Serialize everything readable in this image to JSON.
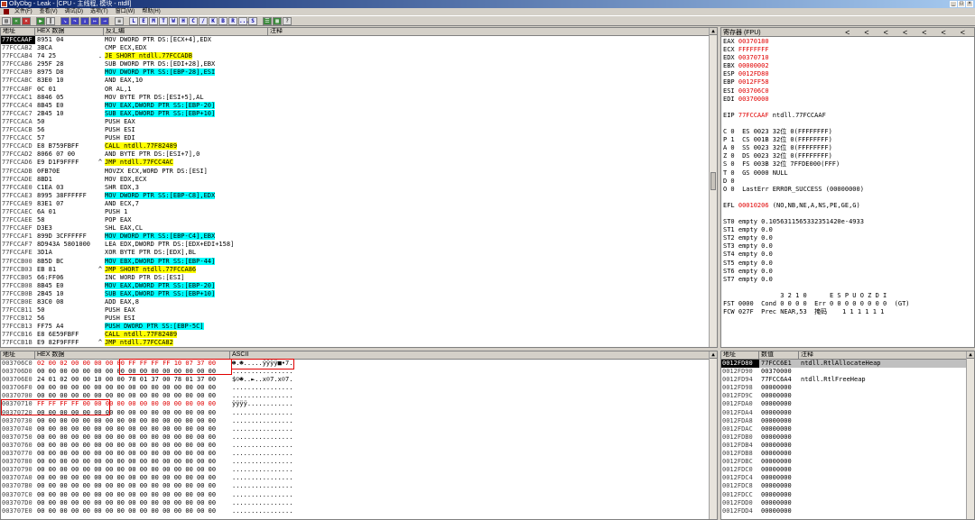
{
  "window": {
    "title": "OllyDbg - Leak - [CPU - 主线程, 模块 - ntdll]"
  },
  "menu": [
    "文件(F)",
    "查看(V)",
    "调试(D)",
    "选项(T)",
    "窗口(W)",
    "帮助(H)"
  ],
  "toolbar": {
    "letters": [
      "L",
      "E",
      "M",
      "T",
      "W",
      "H",
      "C",
      "/",
      "K",
      "B",
      "R",
      "...",
      "S"
    ]
  },
  "disasm": {
    "headers": [
      "地址",
      "HEX 数据",
      "反汇编",
      "注释"
    ],
    "rows": [
      {
        "addr": "77FCCAAF",
        "hex": "8951 04",
        "jmp": "",
        "code": "MOV DWORD PTR DS:[ECX+4],EDX",
        "hl": "",
        "sel": true
      },
      {
        "addr": "77FCCAB2",
        "hex": "3BCA",
        "jmp": "",
        "code": "CMP ECX,EDX",
        "hl": ""
      },
      {
        "addr": "77FCCAB4",
        "hex": "74 25",
        "jmp": ".",
        "code": "JE SHORT ntdll.77FCCADB",
        "hl": "y"
      },
      {
        "addr": "77FCCAB6",
        "hex": "295F 28",
        "jmp": "",
        "code": "SUB DWORD PTR DS:[EDI+28],EBX",
        "hl": ""
      },
      {
        "addr": "77FCCAB9",
        "hex": "8975 D8",
        "jmp": "",
        "code": "MOV DWORD PTR SS:[EBP-28],ESI",
        "hl": "c"
      },
      {
        "addr": "77FCCABC",
        "hex": "83E0 10",
        "jmp": "",
        "code": "AND EAX,10",
        "hl": ""
      },
      {
        "addr": "77FCCABF",
        "hex": "0C 01",
        "jmp": "",
        "code": "OR AL,1",
        "hl": ""
      },
      {
        "addr": "77FCCAC1",
        "hex": "8846 05",
        "jmp": "",
        "code": "MOV BYTE PTR DS:[ESI+5],AL",
        "hl": ""
      },
      {
        "addr": "77FCCAC4",
        "hex": "8B45 E0",
        "jmp": "",
        "code": "MOV EAX,DWORD PTR SS:[EBP-20]",
        "hl": "c"
      },
      {
        "addr": "77FCCAC7",
        "hex": "2B45 10",
        "jmp": "",
        "code": "SUB EAX,DWORD PTR SS:[EBP+10]",
        "hl": "c"
      },
      {
        "addr": "77FCCACA",
        "hex": "50",
        "jmp": "",
        "code": "PUSH EAX",
        "hl": ""
      },
      {
        "addr": "77FCCACB",
        "hex": "56",
        "jmp": "",
        "code": "PUSH ESI",
        "hl": ""
      },
      {
        "addr": "77FCCACC",
        "hex": "57",
        "jmp": "",
        "code": "PUSH EDI",
        "hl": ""
      },
      {
        "addr": "77FCCACD",
        "hex": "E8 B759FBFF",
        "jmp": "",
        "code": "CALL ntdll.77F82489",
        "hl": "y"
      },
      {
        "addr": "77FCCAD2",
        "hex": "8066 07 00",
        "jmp": "",
        "code": "AND BYTE PTR DS:[ESI+7],0",
        "hl": ""
      },
      {
        "addr": "77FCCAD6",
        "hex": "E9 D1F9FFFF",
        "jmp": "^",
        "code": "JMP ntdll.77FCC4AC",
        "hl": "y"
      },
      {
        "addr": "77FCCADB",
        "hex": "0FB70E",
        "jmp": "",
        "code": "MOVZX ECX,WORD PTR DS:[ESI]",
        "hl": ""
      },
      {
        "addr": "77FCCADE",
        "hex": "8BD1",
        "jmp": "",
        "code": "MOV EDX,ECX",
        "hl": ""
      },
      {
        "addr": "77FCCAE0",
        "hex": "C1EA 03",
        "jmp": "",
        "code": "SHR EDX,3",
        "hl": ""
      },
      {
        "addr": "77FCCAE3",
        "hex": "8995 38FFFFFF",
        "jmp": "",
        "code": "MOV DWORD PTR SS:[EBP-C8],EDX",
        "hl": "c"
      },
      {
        "addr": "77FCCAE9",
        "hex": "83E1 07",
        "jmp": "",
        "code": "AND ECX,7",
        "hl": ""
      },
      {
        "addr": "77FCCAEC",
        "hex": "6A 01",
        "jmp": "",
        "code": "PUSH 1",
        "hl": ""
      },
      {
        "addr": "77FCCAEE",
        "hex": "58",
        "jmp": "",
        "code": "POP EAX",
        "hl": ""
      },
      {
        "addr": "77FCCAEF",
        "hex": "D3E3",
        "jmp": "",
        "code": "SHL EAX,CL",
        "hl": ""
      },
      {
        "addr": "77FCCAF1",
        "hex": "899D 3CFFFFFF",
        "jmp": "",
        "code": "MOV DWORD PTR SS:[EBP-C4],EBX",
        "hl": "c"
      },
      {
        "addr": "77FCCAF7",
        "hex": "8D943A 5801000",
        "jmp": "",
        "code": "LEA EDX,DWORD PTR DS:[EDX+EDI+158]",
        "hl": ""
      },
      {
        "addr": "77FCCAFE",
        "hex": "3D1A",
        "jmp": "",
        "code": "XOR BYTE PTR DS:[EDX],BL",
        "hl": ""
      },
      {
        "addr": "77FCCB00",
        "hex": "8B5D BC",
        "jmp": "",
        "code": "MOV EBX,DWORD PTR SS:[EBP-44]",
        "hl": "c"
      },
      {
        "addr": "77FCCB03",
        "hex": "EB 81",
        "jmp": "^",
        "code": "JMP SHORT ntdll.77FCCA86",
        "hl": "y"
      },
      {
        "addr": "77FCCB05",
        "hex": "66:FF06",
        "jmp": "",
        "code": "INC WORD PTR DS:[ESI]",
        "hl": ""
      },
      {
        "addr": "77FCCB08",
        "hex": "8B45 E0",
        "jmp": "",
        "code": "MOV EAX,DWORD PTR SS:[EBP-20]",
        "hl": "c"
      },
      {
        "addr": "77FCCB0B",
        "hex": "2B45 10",
        "jmp": "",
        "code": "SUB EAX,DWORD PTR SS:[EBP+10]",
        "hl": "c"
      },
      {
        "addr": "77FCCB0E",
        "hex": "83C0 08",
        "jmp": "",
        "code": "ADD EAX,8",
        "hl": ""
      },
      {
        "addr": "77FCCB11",
        "hex": "50",
        "jmp": "",
        "code": "PUSH EAX",
        "hl": ""
      },
      {
        "addr": "77FCCB12",
        "hex": "56",
        "jmp": "",
        "code": "PUSH ESI",
        "hl": ""
      },
      {
        "addr": "77FCCB13",
        "hex": "FF75 A4",
        "jmp": "",
        "code": "PUSH DWORD PTR SS:[EBP-5C]",
        "hl": "c"
      },
      {
        "addr": "77FCCB16",
        "hex": "E8 6E59FBFF",
        "jmp": "",
        "code": "CALL ntdll.77F82489",
        "hl": "y"
      },
      {
        "addr": "77FCCB1B",
        "hex": "E9 82F9FFFF",
        "jmp": "^",
        "code": "JMP ntdll.77FCCA82",
        "hl": "y"
      }
    ]
  },
  "registers": {
    "title": "寄存器 (FPU)",
    "nav": [
      "<",
      "<",
      "<",
      "<",
      "<",
      "<",
      "<"
    ],
    "gp": [
      {
        "name": "EAX",
        "val": "00370180"
      },
      {
        "name": "ECX",
        "val": "FFFFFFFF"
      },
      {
        "name": "EDX",
        "val": "00370710"
      },
      {
        "name": "EBX",
        "val": "00000002"
      },
      {
        "name": "ESP",
        "val": "0012FD80"
      },
      {
        "name": "EBP",
        "val": "0012FF58"
      },
      {
        "name": "ESI",
        "val": "003706C0"
      },
      {
        "name": "EDI",
        "val": "00370000"
      }
    ],
    "eip": {
      "name": "EIP",
      "val": "77FCCAAF",
      "sym": "ntdll.77FCCAAF"
    },
    "flags": [
      "C 0  ES 0023 32位 0(FFFFFFFF)",
      "P 1  CS 001B 32位 0(FFFFFFFF)",
      "A 0  SS 0023 32位 0(FFFFFFFF)",
      "Z 0  DS 0023 32位 0(FFFFFFFF)",
      "S 0  FS 003B 32位 7FFDE000(FFF)",
      "T 0  GS 0000 NULL",
      "D 0",
      "O 0  LastErr ERROR_SUCCESS (00000000)"
    ],
    "efl": {
      "name": "EFL",
      "val": "00010206",
      "desc": "(NO,NB,NE,A,NS,PE,GE,G)"
    },
    "fpu": [
      "ST0 empty 0.1056311565332351420e-4933",
      "ST1 empty 0.0",
      "ST2 empty 0.0",
      "ST3 empty 0.0",
      "ST4 empty 0.0",
      "ST5 empty 0.0",
      "ST6 empty 0.0",
      "ST7 empty 0.0"
    ],
    "fpu_status": [
      "               3 2 1 0      E S P U O Z D I",
      "FST 0000  Cond 0 0 0 0  Err 0 0 0 0 0 0 0 0  (GT)",
      "FCW 027F  Prec NEAR,53  掩码    1 1 1 1 1 1"
    ]
  },
  "dump": {
    "headers": [
      "地址",
      "HEX 数据",
      "ASCII"
    ],
    "rows": [
      {
        "addr": "003706C0",
        "hex": "02 00 02 00 00 00 00 00 FF FF FF FF 10 07 37 00",
        "ascii": "☻.☻.....ÿÿÿÿ■•7."
      },
      {
        "addr": "003706D0",
        "hex": "00 00 00 00 00 00 00 00 00 00 00 00 00 00 00 00",
        "ascii": "................"
      },
      {
        "addr": "003706E0",
        "hex": "24 01 02 00 00 10 00 00 78 01 37 00 78 01 37 00",
        "ascii": "$☺☻..►..x☺7.x☺7."
      },
      {
        "addr": "003706F0",
        "hex": "00 00 00 00 00 00 00 00 00 00 00 00 00 00 00 00",
        "ascii": "................"
      },
      {
        "addr": "00370700",
        "hex": "00 00 00 00 00 00 00 00 00 00 00 00 00 00 00 00",
        "ascii": "................"
      },
      {
        "addr": "00370710",
        "hex": "FF FF FF FF 00 00 00 00 00 00 00 00 00 00 00 00",
        "ascii": "ÿÿÿÿ............"
      },
      {
        "addr": "00370720",
        "hex": "00 00 00 00 00 00 00 00 00 00 00 00 00 00 00 00",
        "ascii": "................"
      },
      {
        "addr": "00370730",
        "hex": "00 00 00 00 00 00 00 00 00 00 00 00 00 00 00 00",
        "ascii": "................"
      },
      {
        "addr": "00370740",
        "hex": "00 00 00 00 00 00 00 00 00 00 00 00 00 00 00 00",
        "ascii": "................"
      },
      {
        "addr": "00370750",
        "hex": "00 00 00 00 00 00 00 00 00 00 00 00 00 00 00 00",
        "ascii": "................"
      },
      {
        "addr": "00370760",
        "hex": "00 00 00 00 00 00 00 00 00 00 00 00 00 00 00 00",
        "ascii": "................"
      },
      {
        "addr": "00370770",
        "hex": "00 00 00 00 00 00 00 00 00 00 00 00 00 00 00 00",
        "ascii": "................"
      },
      {
        "addr": "00370780",
        "hex": "00 00 00 00 00 00 00 00 00 00 00 00 00 00 00 00",
        "ascii": "................"
      },
      {
        "addr": "00370790",
        "hex": "00 00 00 00 00 00 00 00 00 00 00 00 00 00 00 00",
        "ascii": "................"
      },
      {
        "addr": "003707A0",
        "hex": "00 00 00 00 00 00 00 00 00 00 00 00 00 00 00 00",
        "ascii": "................"
      },
      {
        "addr": "003707B0",
        "hex": "00 00 00 00 00 00 00 00 00 00 00 00 00 00 00 00",
        "ascii": "................"
      },
      {
        "addr": "003707C0",
        "hex": "00 00 00 00 00 00 00 00 00 00 00 00 00 00 00 00",
        "ascii": "................"
      },
      {
        "addr": "003707D0",
        "hex": "00 00 00 00 00 00 00 00 00 00 00 00 00 00 00 00",
        "ascii": "................"
      },
      {
        "addr": "003707E0",
        "hex": "00 00 00 00 00 00 00 00 00 00 00 00 00 00 00 00",
        "ascii": "................"
      }
    ]
  },
  "stack": {
    "headers": [
      "地址",
      "数值",
      "注释"
    ],
    "rows": [
      {
        "addr": "0012FD80",
        "val": "77FCC6E1",
        "cmt": "ntdll.RtlAllocateHeap",
        "sel": true
      },
      {
        "addr": "0012FD90",
        "val": "00370000",
        "cmt": ""
      },
      {
        "addr": "0012FD94",
        "val": "77FCC6A4",
        "cmt": "ntdll.RtlFreeHeap"
      },
      {
        "addr": "0012FD98",
        "val": "00000000",
        "cmt": ""
      },
      {
        "addr": "0012FD9C",
        "val": "00000000",
        "cmt": ""
      },
      {
        "addr": "0012FDA0",
        "val": "00000000",
        "cmt": ""
      },
      {
        "addr": "0012FDA4",
        "val": "00000000",
        "cmt": ""
      },
      {
        "addr": "0012FDA8",
        "val": "00000000",
        "cmt": ""
      },
      {
        "addr": "0012FDAC",
        "val": "00000000",
        "cmt": ""
      },
      {
        "addr": "0012FDB0",
        "val": "00000000",
        "cmt": ""
      },
      {
        "addr": "0012FDB4",
        "val": "00000000",
        "cmt": ""
      },
      {
        "addr": "0012FDB8",
        "val": "00000000",
        "cmt": ""
      },
      {
        "addr": "0012FDBC",
        "val": "00000000",
        "cmt": ""
      },
      {
        "addr": "0012FDC0",
        "val": "00000000",
        "cmt": ""
      },
      {
        "addr": "0012FDC4",
        "val": "00000000",
        "cmt": ""
      },
      {
        "addr": "0012FDC8",
        "val": "00000000",
        "cmt": ""
      },
      {
        "addr": "0012FDCC",
        "val": "00000000",
        "cmt": ""
      },
      {
        "addr": "0012FDD0",
        "val": "00000000",
        "cmt": ""
      },
      {
        "addr": "0012FDD4",
        "val": "00000000",
        "cmt": ""
      }
    ]
  },
  "colors": {
    "highlight_yellow": "#ffff00",
    "highlight_cyan": "#00ffff",
    "register_changed": "#e00000",
    "annotation_box": "#e00000"
  }
}
